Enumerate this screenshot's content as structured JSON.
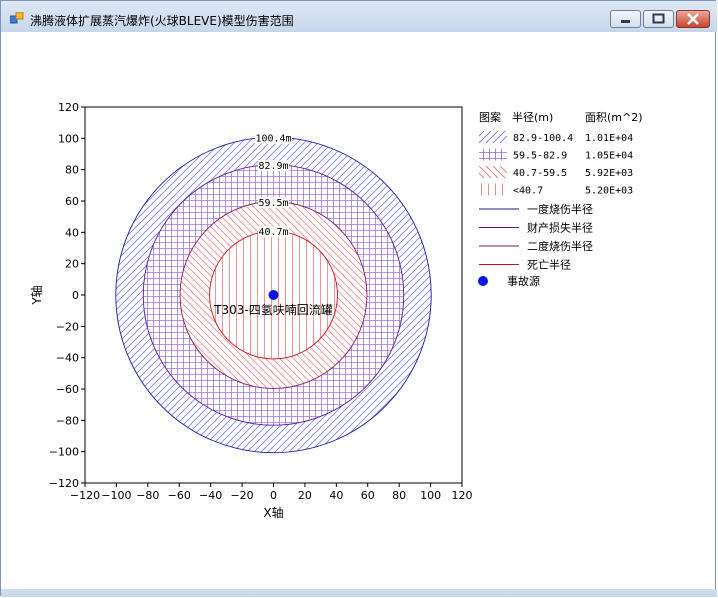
{
  "window": {
    "title": "沸腾液体扩展蒸汽爆炸(火球BLEVE)模型伤害范围",
    "controls": [
      "minimize-icon",
      "maximize-icon",
      "close-icon"
    ]
  },
  "chart_data": {
    "type": "concentric-circles",
    "xlabel": "X轴",
    "ylabel": "Y轴",
    "xlim": [
      -120,
      120
    ],
    "ylim": [
      -120,
      120
    ],
    "xticks": [
      "−120",
      "−100",
      "−80",
      "−60",
      "−40",
      "−20",
      "0",
      "20",
      "40",
      "60",
      "80",
      "100",
      "120"
    ],
    "yticks": [
      "120",
      "100",
      "80",
      "60",
      "40",
      "20",
      "0",
      "−20",
      "−40",
      "−60",
      "−80",
      "−100",
      "−120"
    ],
    "tick_step": 20,
    "origin": {
      "x": 0,
      "y": 0
    },
    "source_label": "T303-四氢呋喃回流罐",
    "circles": [
      {
        "radius": 100.4,
        "label": "100.4m",
        "color": "#1a1aa0",
        "fill_color": "#7a7aff",
        "pattern": "diag-forward"
      },
      {
        "radius": 82.9,
        "label": "82.9m",
        "color": "#5a1a9a",
        "fill_color": "#9a72f2",
        "pattern": "grid"
      },
      {
        "radius": 59.5,
        "label": "59.5m",
        "color": "#8a1a5a",
        "fill_color": "#ef8a8a",
        "pattern": "diag-back"
      },
      {
        "radius": 40.7,
        "label": "40.7m",
        "color": "#c81414",
        "fill_color": "#ec7a7a",
        "pattern": "vertical"
      }
    ]
  },
  "legend": {
    "headers": {
      "pattern": "图案",
      "radius": "半径(m)",
      "area": "面积(m^2)"
    },
    "areas": [
      {
        "range": "82.9-100.4",
        "area": "1.01E+04",
        "pattern": "diag-forward",
        "color": "#6a6af0"
      },
      {
        "range": "59.5-82.9",
        "area": "1.05E+04",
        "pattern": "grid",
        "color": "#8a62e8"
      },
      {
        "range": "40.7-59.5",
        "area": "5.92E+03",
        "pattern": "diag-back",
        "color": "#e46a6a"
      },
      {
        "range": "<40.7",
        "area": "5.20E+03",
        "pattern": "vertical",
        "color": "#e46a6a"
      }
    ],
    "lines": [
      {
        "label": "一度烧伤半径",
        "color": "#1a1aa0"
      },
      {
        "label": "财产损失半径",
        "color": "#5a1a9a"
      },
      {
        "label": "二度烧伤半径",
        "color": "#8a1a5a"
      },
      {
        "label": "死亡半径",
        "color": "#c81414"
      }
    ],
    "marker": {
      "label": "事故源",
      "color": "#0a14e6"
    }
  }
}
